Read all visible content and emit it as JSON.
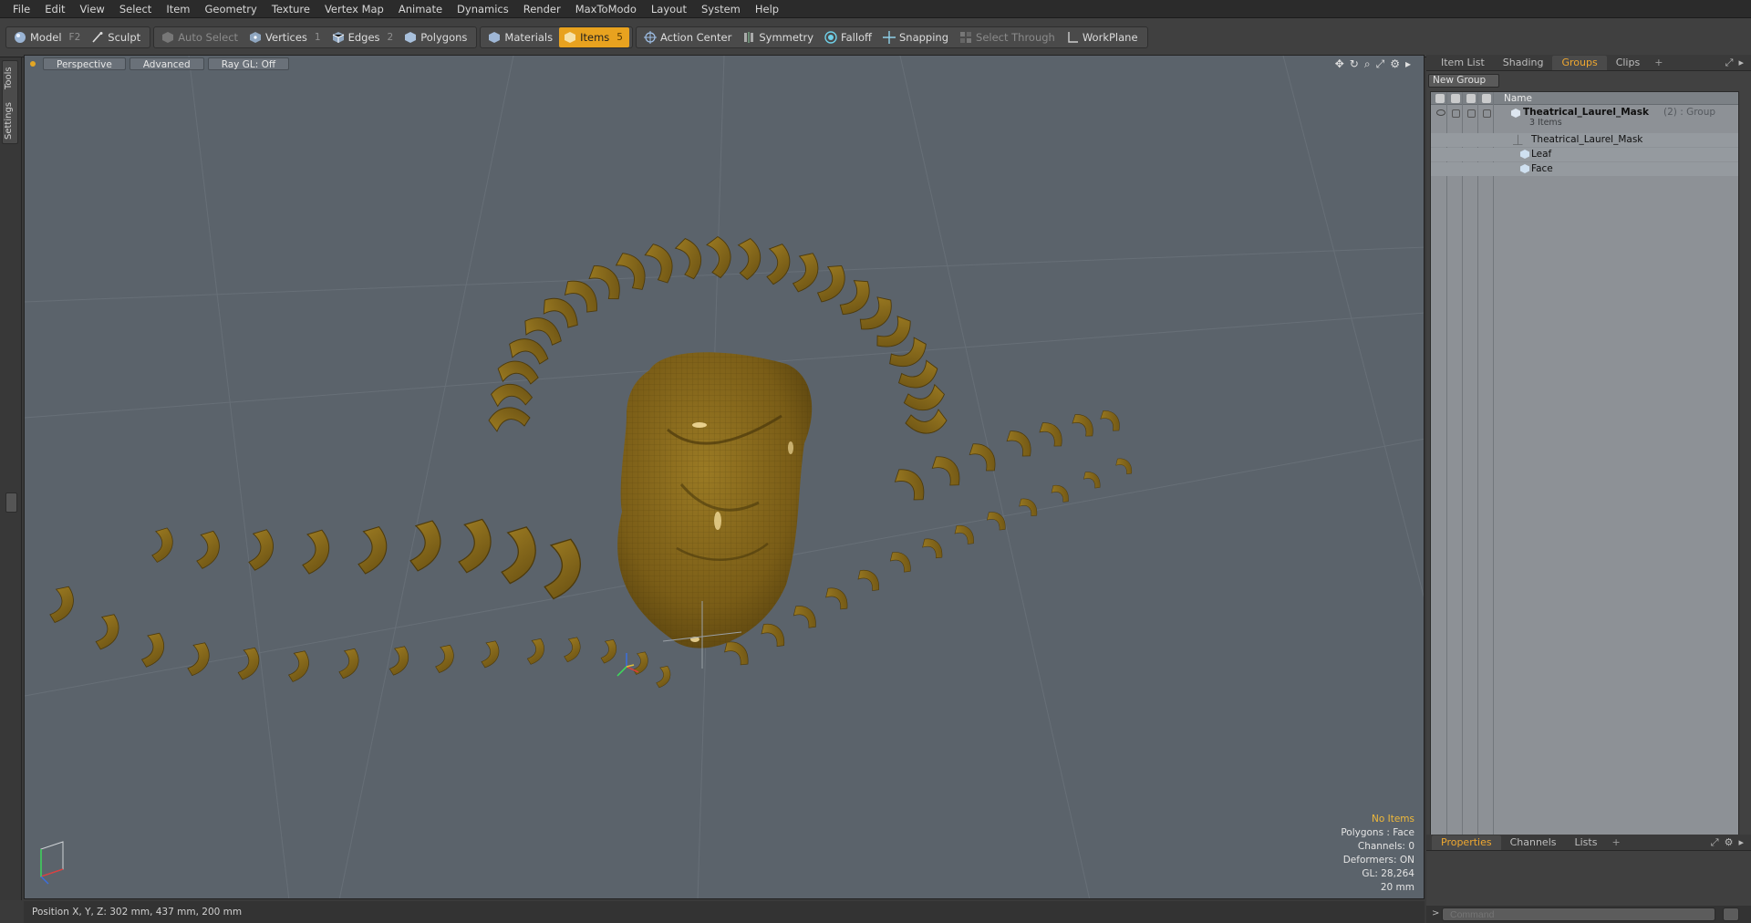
{
  "menu": [
    "File",
    "Edit",
    "View",
    "Select",
    "Item",
    "Geometry",
    "Texture",
    "Vertex Map",
    "Animate",
    "Dynamics",
    "Render",
    "MaxToModo",
    "Layout",
    "System",
    "Help"
  ],
  "toolbar": {
    "model": "Model",
    "model_key": "F2",
    "sculpt": "Sculpt",
    "auto_select": "Auto Select",
    "vertices": "Vertices",
    "vertices_key": "1",
    "edges": "Edges",
    "edges_key": "2",
    "polygons": "Polygons",
    "materials": "Materials",
    "items": "Items",
    "items_key": "5",
    "action_center": "Action Center",
    "symmetry": "Symmetry",
    "falloff": "Falloff",
    "snapping": "Snapping",
    "select_through": "Select Through",
    "workplane": "WorkPlane"
  },
  "left_tabs": {
    "tools": "Tools",
    "settings": "Settings"
  },
  "viewport": {
    "view": "Perspective",
    "shading": "Advanced",
    "raygl": "Ray GL: Off",
    "info": {
      "selection": "No Items",
      "polygons": "Polygons : Face",
      "channels": "Channels: 0",
      "deformers": "Deformers: ON",
      "gl": "GL: 28,264",
      "grid": "20 mm"
    }
  },
  "status": {
    "position": "Position X, Y, Z:  302 mm, 437 mm, 200 mm"
  },
  "right_panel": {
    "tabs": [
      "Item List",
      "Shading",
      "Groups",
      "Clips"
    ],
    "active_tab": "Groups",
    "new_group": "New Group",
    "tree_header": "Name",
    "group": {
      "name": "Theatrical_Laurel_Mask",
      "suffix": "(2) : Group",
      "count": "3 Items"
    },
    "children": [
      "Theatrical_Laurel_Mask",
      "Leaf",
      "Face"
    ],
    "bottom_tabs": [
      "Properties",
      "Channels",
      "Lists"
    ],
    "bottom_active": "Properties",
    "command_placeholder": "Command"
  },
  "colors": {
    "accent": "#e8a21f",
    "model_gold": "#8a6a1c",
    "viewport_bg": "#5b636b"
  }
}
